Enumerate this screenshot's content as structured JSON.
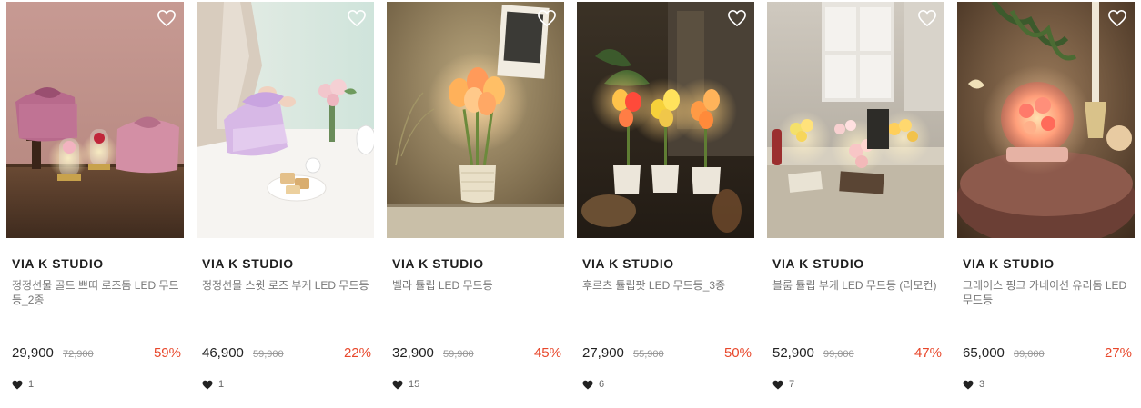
{
  "products": [
    {
      "brand": "VIA K STUDIO",
      "name": "정정선물 골드 쁘띠 로즈돔 LED 무드등_2종",
      "price": "29,900",
      "original_price": "72,900",
      "discount": "59%",
      "likes": "1",
      "image": "rose-dome-gift-photo"
    },
    {
      "brand": "VIA K STUDIO",
      "name": "정정선물 스윗 로즈 부케 LED 무드등",
      "price": "46,900",
      "original_price": "59,900",
      "discount": "22%",
      "likes": "1",
      "image": "sweet-rose-bouquet-photo"
    },
    {
      "brand": "VIA K STUDIO",
      "name": "벨라 튤립 LED 무드등",
      "price": "32,900",
      "original_price": "59,900",
      "discount": "45%",
      "likes": "15",
      "image": "bella-tulip-lamp-photo"
    },
    {
      "brand": "VIA K STUDIO",
      "name": "후르츠 튤립팟 LED 무드등_3종",
      "price": "27,900",
      "original_price": "55,900",
      "discount": "50%",
      "likes": "6",
      "image": "fruits-tulip-pot-photo"
    },
    {
      "brand": "VIA K STUDIO",
      "name": "블룸 튤립 부케 LED 무드등 (리모컨)",
      "price": "52,900",
      "original_price": "99,000",
      "discount": "47%",
      "likes": "7",
      "image": "bloom-tulip-bouquet-photo"
    },
    {
      "brand": "VIA K STUDIO",
      "name": "그레이스 핑크 카네이션 유리돔 LED 무드등",
      "price": "65,000",
      "original_price": "89,000",
      "discount": "27%",
      "likes": "3",
      "image": "grace-carnation-dome-photo"
    }
  ],
  "icons": {
    "wishlist": "heart-outline-icon",
    "like": "heart-filled-icon"
  },
  "colors": {
    "discount": "#e8472b",
    "brand_text": "#1f1f1f",
    "name_text": "#777777",
    "strike_price": "#999999"
  }
}
